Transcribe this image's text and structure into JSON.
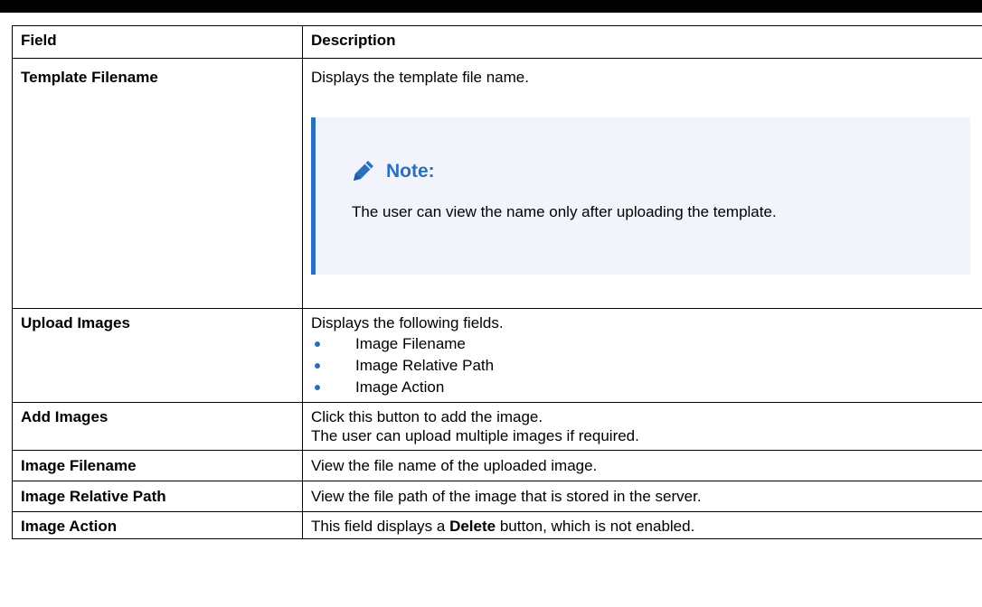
{
  "table": {
    "headers": {
      "field": "Field",
      "description": "Description"
    },
    "rows": {
      "template_filename": {
        "field": "Template Filename",
        "description": "Displays the template file name.",
        "note": {
          "icon": "pencil-icon",
          "title": "Note:",
          "text": "The user can view the name only after uploading the template."
        }
      },
      "upload_images": {
        "field": "Upload Images",
        "description": "Displays the following fields.",
        "items": [
          "Image Filename",
          "Image Relative Path",
          "Image Action"
        ]
      },
      "add_images": {
        "field": "Add Images",
        "lines": [
          "Click this button to add the image.",
          "The user can upload multiple images if required."
        ]
      },
      "image_filename": {
        "field": "Image Filename",
        "description": "View the file name of the uploaded image."
      },
      "image_relative_path": {
        "field": "Image Relative Path",
        "description": "View the file path of the image that is stored in the server."
      },
      "image_action": {
        "field": "Image Action",
        "description_before": "This field displays a ",
        "description_bold": "Delete",
        "description_after": " button, which is not enabled."
      }
    }
  },
  "colors": {
    "accent": "#2c6fbd",
    "note_background": "#f1f5fb"
  }
}
